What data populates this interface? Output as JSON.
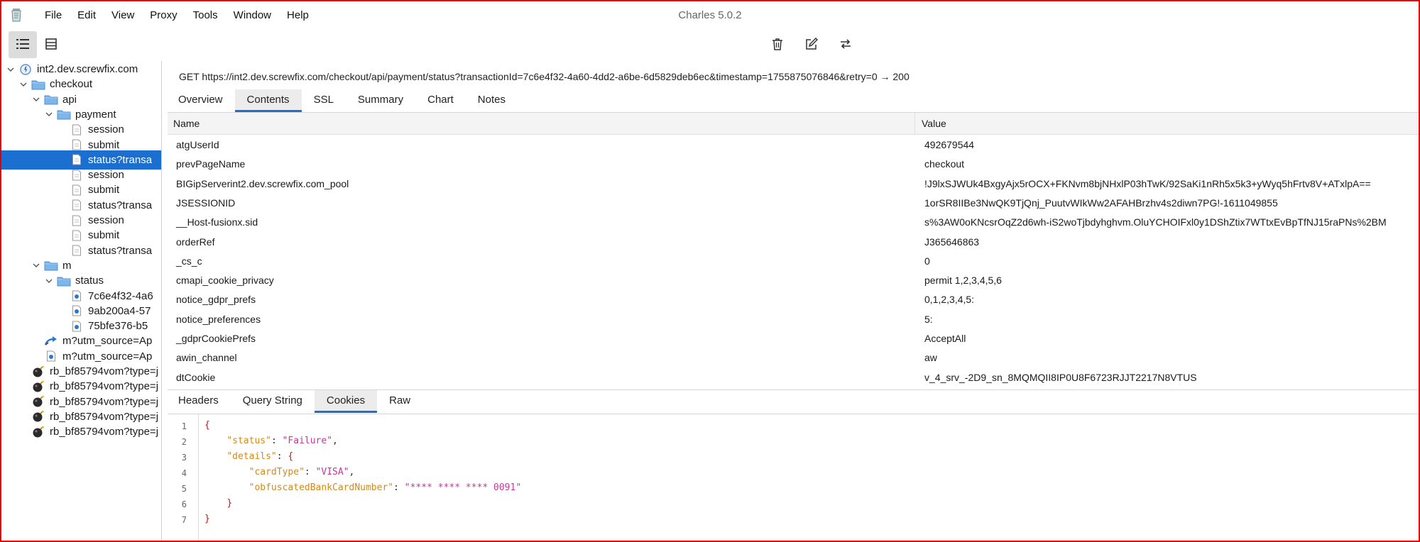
{
  "app": {
    "window_title": "Charles 5.0.2"
  },
  "menu": [
    "File",
    "Edit",
    "View",
    "Proxy",
    "Tools",
    "Window",
    "Help"
  ],
  "icons": {
    "app": "charles-jar-icon",
    "structure_view": "structure-view-icon",
    "sequence_view": "sequence-view-icon",
    "clear": "trash-icon",
    "edit": "edit-icon",
    "repeat": "repeat-icon",
    "host": "globe-icon",
    "folder": "folder-icon",
    "document": "document-icon",
    "response": "json-response-icon",
    "redirect": "redirect-icon",
    "blocked": "blocked-bomb-icon"
  },
  "colors": {
    "selection": "#1a6fd0",
    "json_key": "#d28a1e",
    "json_string": "#c23a9a",
    "json_punct": "#d01010"
  },
  "tree": [
    {
      "label": "int2.dev.screwfix.com",
      "depth": 0,
      "icon": "host",
      "toggle": "down"
    },
    {
      "label": "checkout",
      "depth": 1,
      "icon": "folder",
      "toggle": "down"
    },
    {
      "label": "api",
      "depth": 2,
      "icon": "folder",
      "toggle": "down"
    },
    {
      "label": "payment",
      "depth": 3,
      "icon": "folder",
      "toggle": "down"
    },
    {
      "label": "session",
      "depth": 4,
      "icon": "document"
    },
    {
      "label": "submit",
      "depth": 4,
      "icon": "document"
    },
    {
      "label": "status?transa",
      "depth": 4,
      "icon": "document",
      "selected": true
    },
    {
      "label": "session",
      "depth": 4,
      "icon": "document"
    },
    {
      "label": "submit",
      "depth": 4,
      "icon": "document"
    },
    {
      "label": "status?transa",
      "depth": 4,
      "icon": "document"
    },
    {
      "label": "session",
      "depth": 4,
      "icon": "document"
    },
    {
      "label": "submit",
      "depth": 4,
      "icon": "document"
    },
    {
      "label": "status?transa",
      "depth": 4,
      "icon": "document"
    },
    {
      "label": "m",
      "depth": 2,
      "icon": "folder",
      "toggle": "down"
    },
    {
      "label": "status",
      "depth": 3,
      "icon": "folder",
      "toggle": "down"
    },
    {
      "label": "7c6e4f32-4a6",
      "depth": 4,
      "icon": "response"
    },
    {
      "label": "9ab200a4-57",
      "depth": 4,
      "icon": "response"
    },
    {
      "label": "75bfe376-b5",
      "depth": 4,
      "icon": "response"
    },
    {
      "label": "m?utm_source=Ap",
      "depth": 2,
      "icon": "redirect"
    },
    {
      "label": "m?utm_source=Ap",
      "depth": 2,
      "icon": "response"
    },
    {
      "label": "rb_bf85794vom?type=j",
      "depth": 1,
      "icon": "blocked"
    },
    {
      "label": "rb_bf85794vom?type=j",
      "depth": 1,
      "icon": "blocked"
    },
    {
      "label": "rb_bf85794vom?type=j",
      "depth": 1,
      "icon": "blocked"
    },
    {
      "label": "rb_bf85794vom?type=j",
      "depth": 1,
      "icon": "blocked"
    },
    {
      "label": "rb_bf85794vom?type=j",
      "depth": 1,
      "icon": "blocked"
    }
  ],
  "request_line": "GET https://int2.dev.screwfix.com/checkout/api/payment/status?transactionId=7c6e4f32-4a60-4dd2-a6be-6d5829deb6ec&timestamp=1755875076846&retry=0  → 200",
  "top_tabs": [
    {
      "label": "Overview"
    },
    {
      "label": "Contents",
      "active": true
    },
    {
      "label": "SSL"
    },
    {
      "label": "Summary"
    },
    {
      "label": "Chart"
    },
    {
      "label": "Notes"
    }
  ],
  "table": {
    "columns": {
      "name": "Name",
      "value": "Value"
    },
    "rows": [
      {
        "name": "atgUserId",
        "value": "492679544"
      },
      {
        "name": "prevPageName",
        "value": "checkout"
      },
      {
        "name": "BIGipServerint2.dev.screwfix.com_pool",
        "value": "!J9lxSJWUk4BxgyAjx5rOCX+FKNvm8bjNHxlP03hTwK/92SaKi1nRh5x5k3+yWyq5hFrtv8V+ATxlpA=="
      },
      {
        "name": "JSESSIONID",
        "value": "1orSR8IIBe3NwQK9TjQnj_PuutvWIkWw2AFAHBrzhv4s2diwn7PG!-1611049855"
      },
      {
        "name": "__Host-fusionx.sid",
        "value": "s%3AW0oKNcsrOqZ2d6wh-iS2woTjbdyhghvm.OluYCHOIFxl0y1DShZtix7WTtxEvBpTfNJ15raPNs%2BM"
      },
      {
        "name": "orderRef",
        "value": "J365646863"
      },
      {
        "name": "_cs_c",
        "value": "0"
      },
      {
        "name": "cmapi_cookie_privacy",
        "value": "permit 1,2,3,4,5,6"
      },
      {
        "name": "notice_gdpr_prefs",
        "value": "0,1,2,3,4,5:"
      },
      {
        "name": "notice_preferences",
        "value": "5:"
      },
      {
        "name": "_gdprCookiePrefs",
        "value": "AcceptAll"
      },
      {
        "name": "awin_channel",
        "value": "aw"
      },
      {
        "name": "dtCookie",
        "value": "v_4_srv_-2D9_sn_8MQMQII8IP0U8F6723RJJT2217N8VTUS"
      }
    ]
  },
  "bottom_tabs": [
    {
      "label": "Headers"
    },
    {
      "label": "Query String"
    },
    {
      "label": "Cookies",
      "active": true
    },
    {
      "label": "Raw"
    }
  ],
  "code": {
    "line_numbers": [
      "1",
      "2",
      "3",
      "4",
      "5",
      "6",
      "7"
    ],
    "brace_open": "{",
    "status_key": "\"status\"",
    "status_value": "\"Failure\"",
    "details_key": "\"details\"",
    "card_type_key": "\"cardType\"",
    "card_type_value": "\"VISA\"",
    "card_number_key": "\"obfuscatedBankCardNumber\"",
    "card_number_value": "\"**** **** **** 0091\"",
    "colon": ": ",
    "comma": ",",
    "details_open": "{",
    "details_close": "}",
    "brace_close": "}"
  }
}
